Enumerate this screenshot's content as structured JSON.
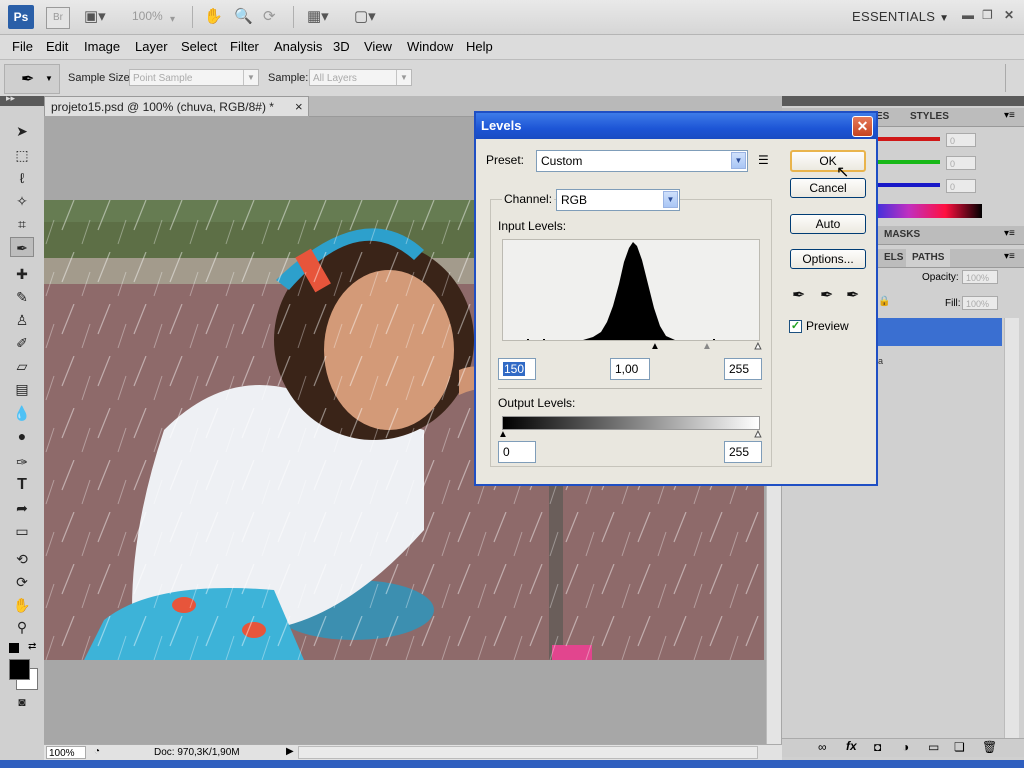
{
  "app": {
    "logo": "Ps",
    "bridge_logo": "Br",
    "zoom_display": "100%",
    "workspace": "ESSENTIALS"
  },
  "menu": [
    "File",
    "Edit",
    "Image",
    "Layer",
    "Select",
    "Filter",
    "Analysis",
    "3D",
    "View",
    "Window",
    "Help"
  ],
  "options_bar": {
    "sample_size_label": "Sample Size:",
    "sample_size_value": "Point Sample",
    "sample_label": "Sample:",
    "sample_value": "All Layers"
  },
  "document": {
    "tab_title": "projeto15.psd @ 100% (chuva, RGB/8#) *",
    "tab_close": "×"
  },
  "status": {
    "zoom": "100%",
    "doc_info": "Doc: 970,3K/1,90M"
  },
  "right_panel": {
    "tab_swatches": "ES",
    "tab_styles": "STYLES",
    "color_values": [
      "0",
      "0",
      "0"
    ],
    "tab_masks": "MASKS",
    "tab_channels": "ELS",
    "tab_paths": "PATHS",
    "opacity_label": "Opacity:",
    "opacity_value": "100%",
    "fill_label": "Fill:",
    "fill_value": "100%",
    "layer_fragment": "a"
  },
  "levels_dialog": {
    "title": "Levels",
    "close": "✕",
    "preset_label": "Preset:",
    "preset_value": "Custom",
    "channel_label": "Channel:",
    "channel_value": "RGB",
    "input_levels_label": "Input Levels:",
    "input_black": "150",
    "input_gamma": "1,00",
    "input_white": "255",
    "output_levels_label": "Output Levels:",
    "output_black": "0",
    "output_white": "255",
    "buttons": {
      "ok": "OK",
      "cancel": "Cancel",
      "auto": "Auto",
      "options": "Options..."
    },
    "preview_label": "Preview",
    "preview_checked": true
  },
  "colors": {
    "dialog_titlebar": "#1d55d6",
    "selection_blue": "#3a6fd1",
    "ok_border": "#e9b44c",
    "slider_red": "#d01818",
    "slider_green": "#18b818",
    "slider_blue": "#1818c8"
  },
  "icons": [
    "move-tool-icon",
    "marquee-tool-icon",
    "lasso-tool-icon",
    "quick-select-icon",
    "crop-tool-icon",
    "eyedropper-tool-icon",
    "healing-brush-icon",
    "brush-tool-icon",
    "clone-stamp-icon",
    "history-brush-icon",
    "eraser-icon",
    "gradient-icon",
    "blur-icon",
    "dodge-icon",
    "pen-tool-icon",
    "type-tool-icon",
    "path-select-icon",
    "shape-tool-icon",
    "3d-rotate-icon",
    "3d-orbit-icon",
    "hand-tool-icon",
    "zoom-tool-icon",
    "foreground-color-swatch",
    "quick-mask-icon"
  ]
}
